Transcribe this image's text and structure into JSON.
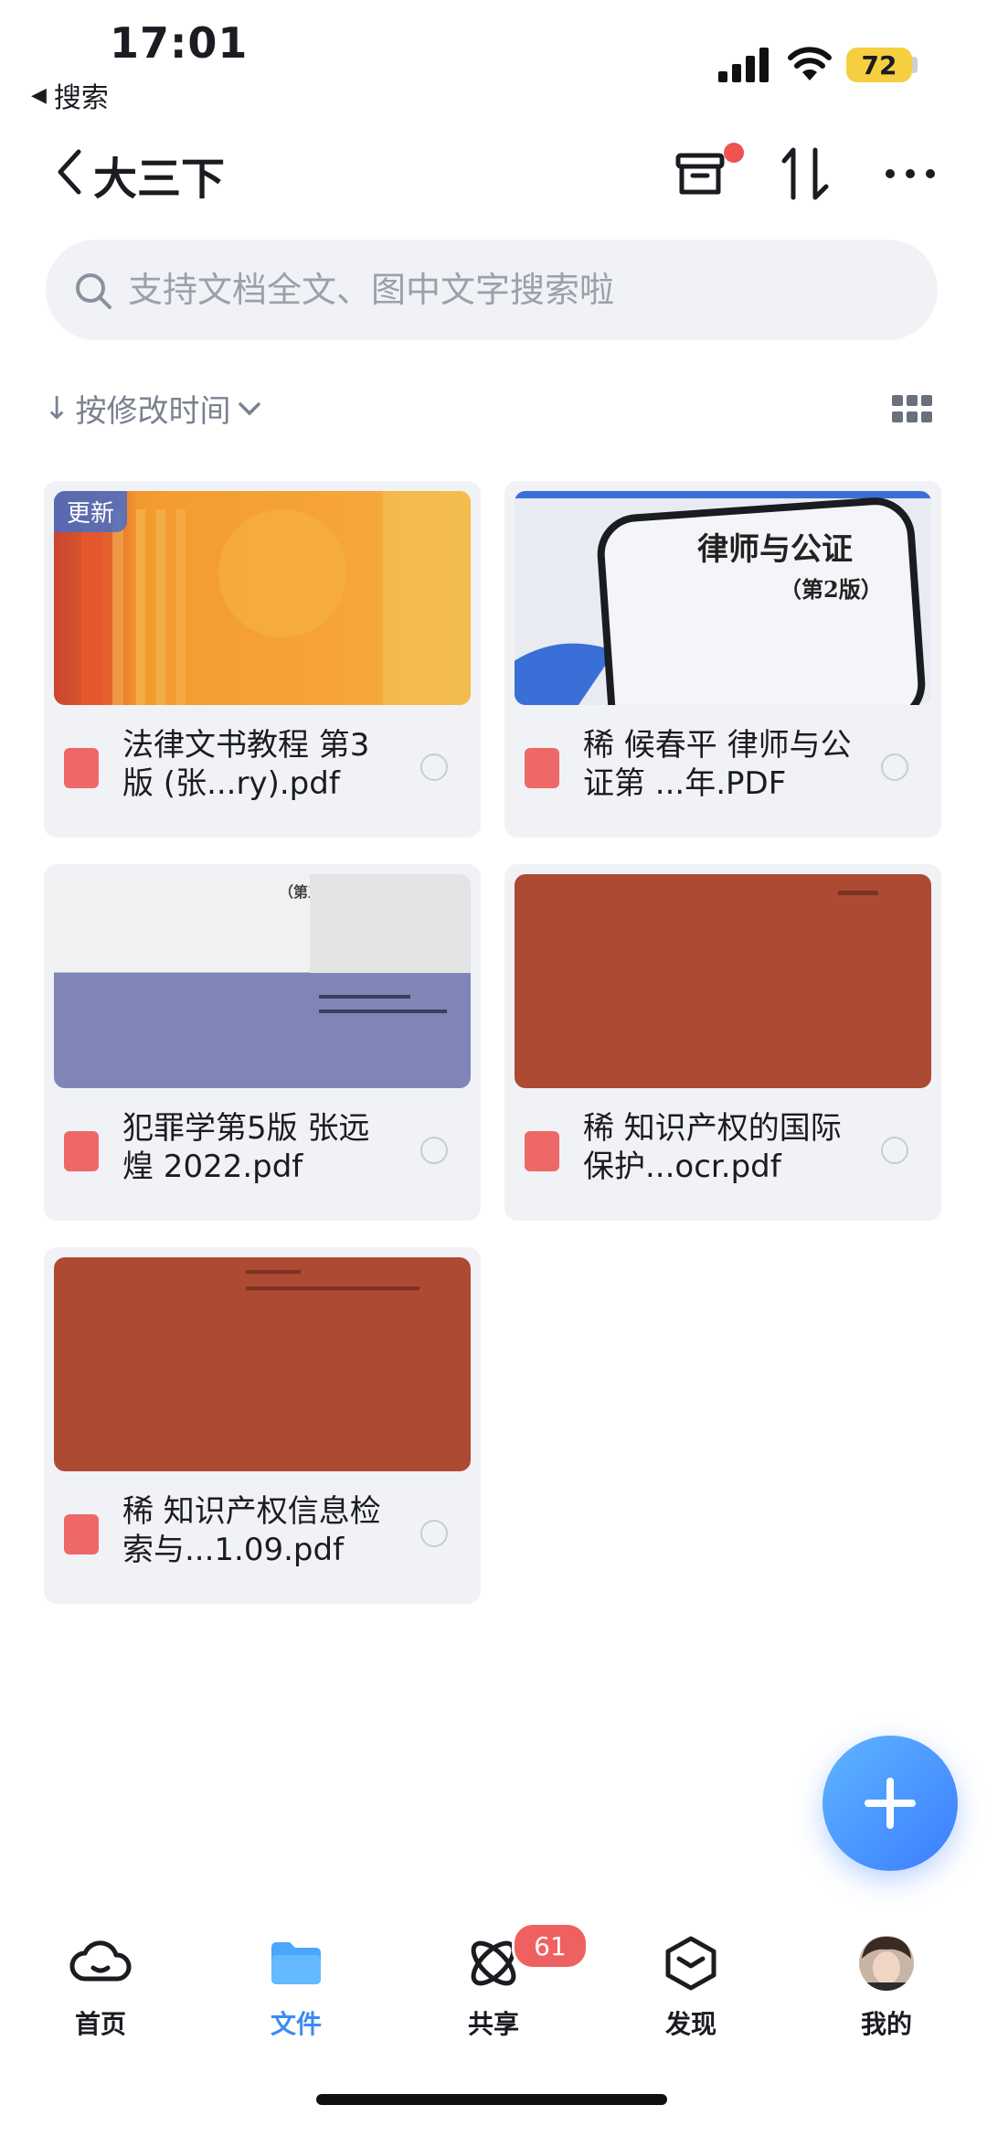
{
  "status": {
    "time": "17:01",
    "back_app": "搜索",
    "battery": "72"
  },
  "header": {
    "title": "大三下"
  },
  "search": {
    "placeholder": "支持文档全文、图中文字搜索啦"
  },
  "sort": {
    "label": "按修改时间"
  },
  "files": [
    {
      "name": "法律文书教程 第3版 (张...ry).pdf",
      "badge": "更新"
    },
    {
      "name": "稀 候春平 律师与公证第 ...年.PDF",
      "thumb_title": "律师与公证",
      "thumb_sub": "（第2版）"
    },
    {
      "name": "犯罪学第5版 张远煌 2022.pdf",
      "thumb_title": "（第五版）"
    },
    {
      "name": "稀 知识产权的国际保护...ocr.pdf"
    },
    {
      "name": "稀 知识产权信息检索与...1.09.pdf"
    }
  ],
  "tabs": [
    {
      "label": "首页"
    },
    {
      "label": "文件"
    },
    {
      "label": "共享",
      "badge": "61"
    },
    {
      "label": "发现"
    },
    {
      "label": "我的"
    }
  ],
  "colors": {
    "accent": "#3b8cf2",
    "pdf": "#ee6868",
    "badge_red": "#ef5350"
  }
}
